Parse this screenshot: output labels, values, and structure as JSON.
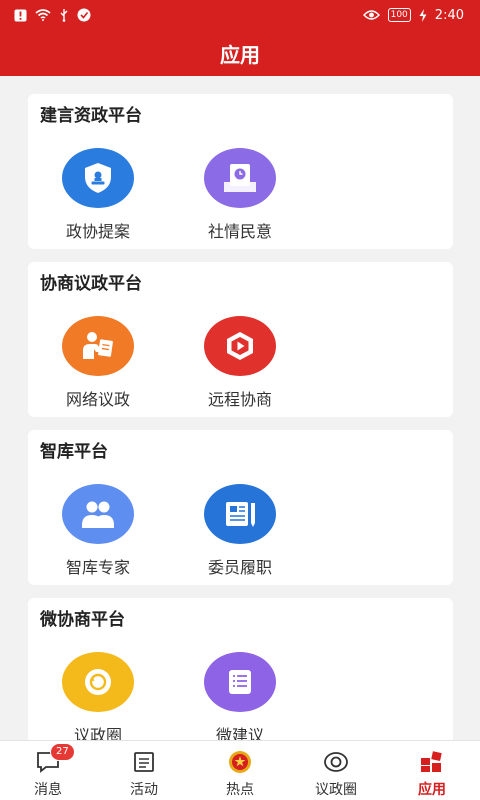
{
  "statusbar": {
    "time": "2:40",
    "battery": "100",
    "icons": [
      "alert-icon",
      "wifi-icon",
      "usb-icon",
      "app-notify-icon",
      "eye-icon",
      "charging-icon"
    ]
  },
  "header": {
    "title": "应用"
  },
  "sections": [
    {
      "title": "建言资政平台",
      "apps": [
        {
          "label": "政协提案",
          "icon": "shield-stamp-icon",
          "color": "#2a7ddf"
        },
        {
          "label": "社情民意",
          "icon": "document-clock-icon",
          "color": "#8b6ce6"
        }
      ]
    },
    {
      "title": "协商议政平台",
      "apps": [
        {
          "label": "网络议政",
          "icon": "person-reading-icon",
          "color": "#f07a26"
        },
        {
          "label": "远程协商",
          "icon": "video-play-icon",
          "color": "#e0312c"
        }
      ]
    },
    {
      "title": "智库平台",
      "apps": [
        {
          "label": "智库专家",
          "icon": "group-users-icon",
          "color": "#5e8ff0"
        },
        {
          "label": "委员履职",
          "icon": "newspaper-pen-icon",
          "color": "#2774d8"
        }
      ]
    },
    {
      "title": "微协商平台",
      "apps": [
        {
          "label": "议政圈",
          "icon": "circle-refresh-icon",
          "color": "#f4b91a"
        },
        {
          "label": "微建议",
          "icon": "list-note-icon",
          "color": "#8f63e5"
        }
      ]
    }
  ],
  "tabbar": {
    "tabs": [
      {
        "label": "消息",
        "icon": "message-icon",
        "badge": "27"
      },
      {
        "label": "活动",
        "icon": "activity-list-icon"
      },
      {
        "label": "热点",
        "icon": "emblem-icon"
      },
      {
        "label": "议政圈",
        "icon": "eye-circle-icon"
      },
      {
        "label": "应用",
        "icon": "apps-grid-icon",
        "active": true
      }
    ],
    "active_color": "#d5201f"
  }
}
